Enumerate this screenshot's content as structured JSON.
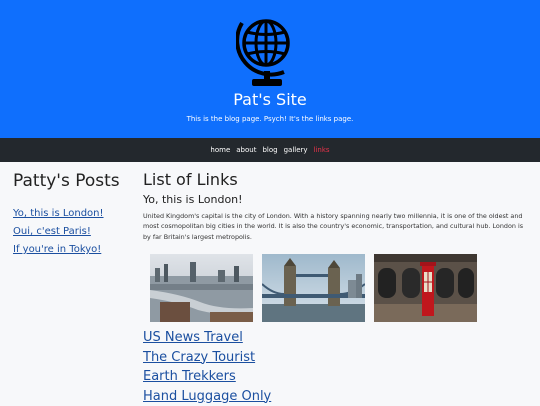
{
  "header": {
    "title": "Pat's Site",
    "tagline": "This is the blog page. Psych! It's the links page."
  },
  "nav": {
    "items": [
      {
        "label": "home",
        "active": false
      },
      {
        "label": "about",
        "active": false
      },
      {
        "label": "blog",
        "active": false
      },
      {
        "label": "gallery",
        "active": false
      },
      {
        "label": "links",
        "active": true
      }
    ],
    "active_color": "#e8334a"
  },
  "sidebar": {
    "heading": "Patty's Posts",
    "posts": [
      {
        "label": "Yo, this is London!"
      },
      {
        "label": "Oui, c'est Paris!"
      },
      {
        "label": "If you're in Tokyo!"
      }
    ]
  },
  "main": {
    "heading": "List of Links",
    "subheading": "Yo, this is London!",
    "paragraph": "United Kingdom's capital is the city of London. With a history spanning nearly two millennia, it is one of the oldest and most cosmopolitan big cities in the world. It is also the country's economic, transportation, and cultural hub. London is by far Britain's largest metropolis.",
    "photos": [
      {
        "name": "london-skyline-photo"
      },
      {
        "name": "tower-bridge-photo"
      },
      {
        "name": "red-phone-box-photo"
      }
    ],
    "links": [
      {
        "label": "US News Travel"
      },
      {
        "label": "The Crazy Tourist"
      },
      {
        "label": "Earth Trekkers"
      },
      {
        "label": "Hand Luggage Only"
      }
    ]
  },
  "colors": {
    "header_bg": "#0f6ffd",
    "navbar_bg": "#23282d",
    "link": "#1b4fa0"
  },
  "icons": {
    "logo": "globe-icon"
  }
}
